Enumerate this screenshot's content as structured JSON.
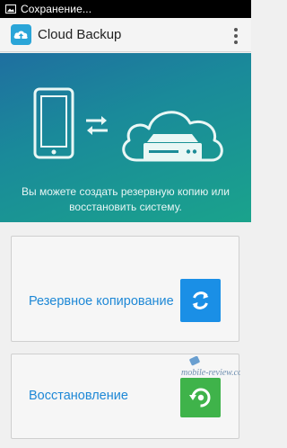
{
  "status_bar": {
    "text": "Сохранение...",
    "icon": "image-icon"
  },
  "action_bar": {
    "app_icon": "cloud-upload-icon",
    "title": "Cloud Backup",
    "menu_icon": "overflow-menu-icon"
  },
  "hero": {
    "icons": [
      "phone-icon",
      "sync-arrows-icon",
      "cloud-drive-icon"
    ],
    "text": "Вы можете создать резервную копию или восстановить систему."
  },
  "backup_card": {
    "label": "Резервное копирование",
    "icon": "backup-refresh-icon",
    "color": "#1a8fe6"
  },
  "restore_card": {
    "label": "Восстановление",
    "icon": "restore-icon",
    "color": "#3fb34a"
  },
  "watermark": {
    "text": "mobile-review.com"
  },
  "colors": {
    "accent": "#1e88d6",
    "hero_start": "#1f6fa0",
    "hero_end": "#1aa38c"
  }
}
